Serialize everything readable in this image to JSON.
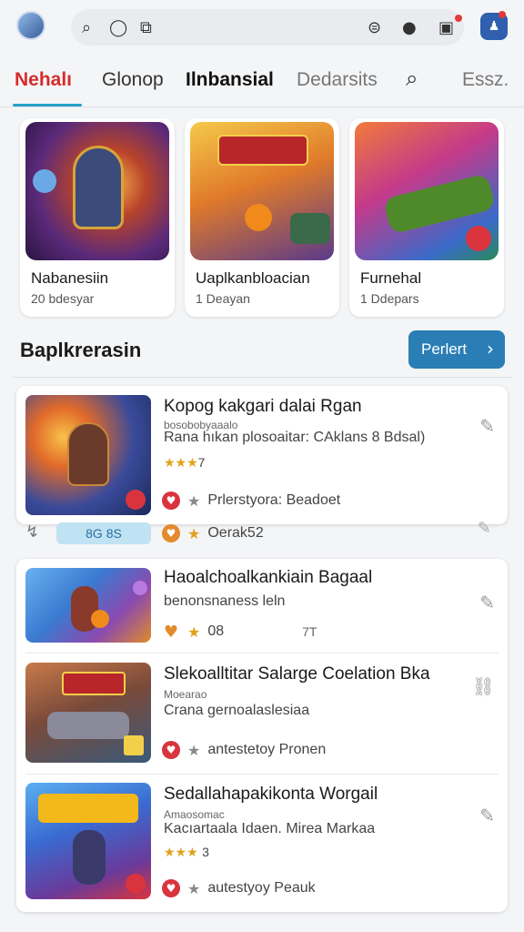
{
  "header": {
    "icons": [
      "avatar",
      "search-icon",
      "refresh-icon",
      "tag-icon",
      "filter-icon",
      "info-icon",
      "notification-icon",
      "profile-icon"
    ]
  },
  "tabs": [
    {
      "label": "Nehalı",
      "state": "active"
    },
    {
      "label": "Glonop"
    },
    {
      "label": "Ilnbansial"
    },
    {
      "label": "Dedarsits"
    },
    {
      "label": "Essz."
    }
  ],
  "featured": [
    {
      "title": "Nabanesiin",
      "sub": "20 bdesyar"
    },
    {
      "title": "Uaplkanbloacian",
      "sub": "1 Deayan"
    },
    {
      "title": "Furnehal",
      "sub": "1 Ddepars"
    }
  ],
  "section": {
    "title": "Baplkrerasin",
    "sort_label": "Perlert"
  },
  "list": {
    "peek": {
      "pill": "8G 8S",
      "foot": "Oerak52"
    },
    "items": [
      {
        "title": "Kopog kakgari dalai Rgan",
        "meta": "bosobobyaaalo",
        "desc": "Rana hıkan plosoaitar: CAklans 8 Bdsal)",
        "rating_label": "7",
        "foot": "Prlerstyora: Beadoet"
      },
      {
        "title": "Haoalchoalkankiain Bagaal",
        "desc": "benonsnaness leln",
        "foot": "08",
        "foot_extra": "7T"
      },
      {
        "title": "Slekoalltitar Salarge Coelation Bka",
        "meta": "Moearao",
        "desc": "Crana gernoalaslesiaa",
        "foot": "antestetoy Pronen"
      },
      {
        "title": "Sedallahapakikonta Worgail",
        "meta": "Amaosomac",
        "desc": "Kacıartaala Idaen. Mirea Markaa",
        "rating_label": "3",
        "foot": "autestyoy Peauk"
      }
    ]
  },
  "colors": {
    "accent": "#d62c2c",
    "tab_underline": "#2aa0c8",
    "sort_button": "#2a7eb5",
    "heart": "#d9343e"
  }
}
